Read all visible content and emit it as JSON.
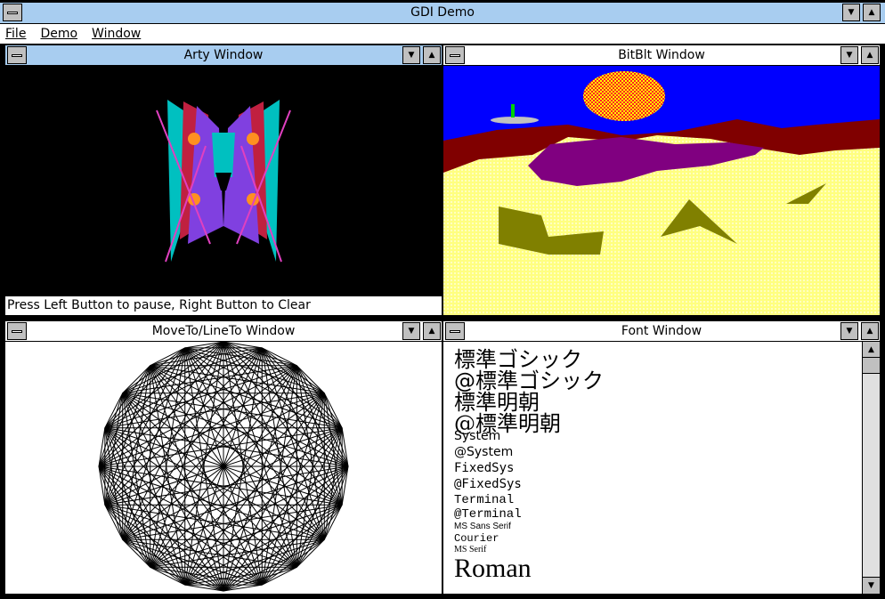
{
  "app": {
    "title": "GDI Demo"
  },
  "menu": [
    "File",
    "Demo",
    "Window"
  ],
  "windows": {
    "arty": {
      "title": "Arty Window",
      "status": "Press Left Button to pause, Right Button to Clear"
    },
    "bitblt": {
      "title": "BitBlt Window"
    },
    "lineto": {
      "title": "MoveTo/LineTo Window"
    },
    "font": {
      "title": "Font Window",
      "lines": [
        "標準ゴシック",
        "@標準ゴシック",
        "標準明朝",
        "@標準明朝",
        "System",
        "@System",
        "FixedSys",
        "@FixedSys",
        "Terminal",
        "@Terminal",
        "MS Sans Serif",
        "Courier",
        "MS Serif",
        "Roman"
      ]
    }
  },
  "icons": {
    "system_menu": "system-menu-icon",
    "minimize": "minimize-arrow-icon",
    "maximize": "maximize-arrow-icon",
    "scroll_up": "scroll-up-arrow-icon",
    "scroll_down": "scroll-down-arrow-icon"
  },
  "colors": {
    "active_title": "#a8cdf0",
    "sky": "#0000ff",
    "sand": "#ffff80",
    "mountain": "#800080",
    "mountain_dark": "#800000",
    "arty_background": "#000000"
  }
}
